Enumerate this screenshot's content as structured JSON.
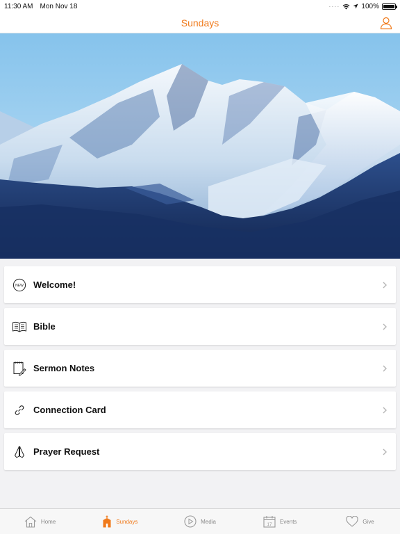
{
  "status": {
    "time": "11:30 AM",
    "date": "Mon Nov 18",
    "battery": "100%",
    "battery_level": 1.0
  },
  "header": {
    "title": "Sundays"
  },
  "menu": [
    {
      "label": "Welcome!",
      "icon": "new-badge-icon"
    },
    {
      "label": "Bible",
      "icon": "open-book-icon"
    },
    {
      "label": "Sermon Notes",
      "icon": "notepad-pencil-icon"
    },
    {
      "label": "Connection Card",
      "icon": "link-icon"
    },
    {
      "label": "Prayer Request",
      "icon": "praying-hands-icon"
    }
  ],
  "new_badge_text": "NEW",
  "tabs": [
    {
      "label": "Home",
      "icon": "home-icon",
      "active": false
    },
    {
      "label": "Sundays",
      "icon": "church-icon",
      "active": true
    },
    {
      "label": "Media",
      "icon": "play-circle-icon",
      "active": false
    },
    {
      "label": "Events",
      "icon": "calendar-icon",
      "active": false
    },
    {
      "label": "Give",
      "icon": "heart-icon",
      "active": false
    }
  ],
  "calendar_day": "17",
  "colors": {
    "accent": "#f07a1b",
    "inactive": "#888888"
  }
}
